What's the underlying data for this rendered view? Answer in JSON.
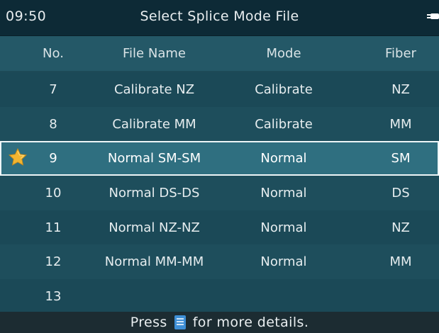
{
  "status": {
    "time": "09:50",
    "title": "Select Splice Mode File",
    "power_icon": "plug-icon"
  },
  "table": {
    "headers": {
      "no": "No.",
      "file_name": "File Name",
      "mode": "Mode",
      "fiber": "Fiber"
    },
    "rows": [
      {
        "no": "7",
        "file_name": "Calibrate NZ",
        "mode": "Calibrate",
        "fiber": "NZ"
      },
      {
        "no": "8",
        "file_name": "Calibrate MM",
        "mode": "Calibrate",
        "fiber": "MM"
      },
      {
        "no": "9",
        "file_name": "Normal SM-SM",
        "mode": "Normal",
        "fiber": "SM",
        "selected": true,
        "marker_icon": "star-icon"
      },
      {
        "no": "10",
        "file_name": "Normal DS-DS",
        "mode": "Normal",
        "fiber": "DS"
      },
      {
        "no": "11",
        "file_name": "Normal NZ-NZ",
        "mode": "Normal",
        "fiber": "NZ"
      },
      {
        "no": "12",
        "file_name": "Normal MM-MM",
        "mode": "Normal",
        "fiber": "MM"
      },
      {
        "no": "13",
        "file_name": "",
        "mode": "",
        "fiber": ""
      }
    ]
  },
  "footer": {
    "prefix": "Press",
    "icon": "document-icon",
    "suffix": "for more details."
  },
  "colors": {
    "background": "#1d4a57",
    "status_bar": "#0d2a36",
    "selected_row": "#2f6f80",
    "star": "#f2b531",
    "doc_icon": "#3e8fd6"
  }
}
